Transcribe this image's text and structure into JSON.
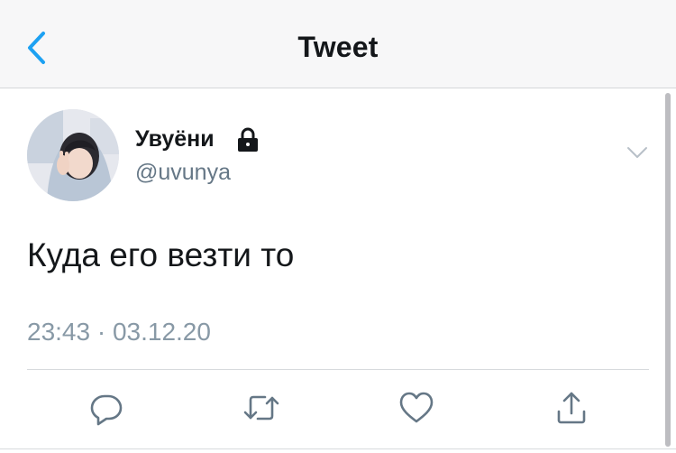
{
  "nav": {
    "title": "Tweet",
    "back_icon": "chevron-left-icon"
  },
  "tweet": {
    "display_name": "Увуёни",
    "handle": "@uvunya",
    "protected_icon": "lock-icon",
    "text": "Куда его везти то",
    "timestamp": "23:43 · 03.12.20"
  },
  "actions": [
    {
      "name": "reply",
      "icon": "reply-icon"
    },
    {
      "name": "retweet",
      "icon": "retweet-icon"
    },
    {
      "name": "like",
      "icon": "heart-icon"
    },
    {
      "name": "share",
      "icon": "share-icon"
    }
  ],
  "colors": {
    "accent": "#1da1f2",
    "text": "#14171a",
    "secondary": "#657786",
    "icon": "#657786"
  }
}
